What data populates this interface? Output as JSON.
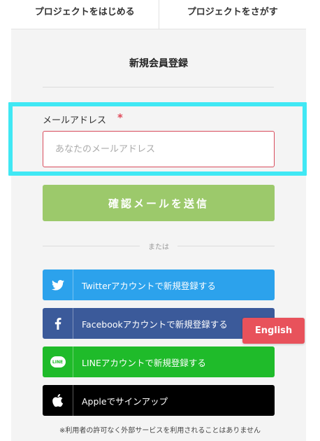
{
  "nav": {
    "tabs": [
      {
        "label": "プロジェクトをはじめる"
      },
      {
        "label": "プロジェクトをさがす"
      }
    ]
  },
  "form": {
    "title": "新規会員登録",
    "email_label": "メールアドレス",
    "required_mark": "*",
    "email_placeholder": "あなたのメールアドレス",
    "email_value": "",
    "confirm_label": "確認メールを送信",
    "or_text": "または"
  },
  "social": {
    "twitter": {
      "label": "Twitterアカウントで新規登録する",
      "icon": "twitter-icon"
    },
    "facebook": {
      "label": "Facebookアカウントで新規登録する",
      "icon": "facebook-icon"
    },
    "line": {
      "label": "LINEアカウントで新規登録する",
      "icon": "line-icon",
      "badge": "LINE"
    },
    "apple": {
      "label": "Appleでサインアップ",
      "icon": "apple-icon"
    }
  },
  "footnote": "※利用者の許可なく外部サービスを利用されることはありません",
  "language_button": "English",
  "colors": {
    "highlight": "#40e8f4",
    "confirm": "#9cc96b",
    "twitter": "#2ca2ec",
    "facebook": "#3b5a9a",
    "line": "#1fbb2a",
    "apple": "#000000",
    "english": "#e8525b",
    "required": "#e04a5a"
  }
}
